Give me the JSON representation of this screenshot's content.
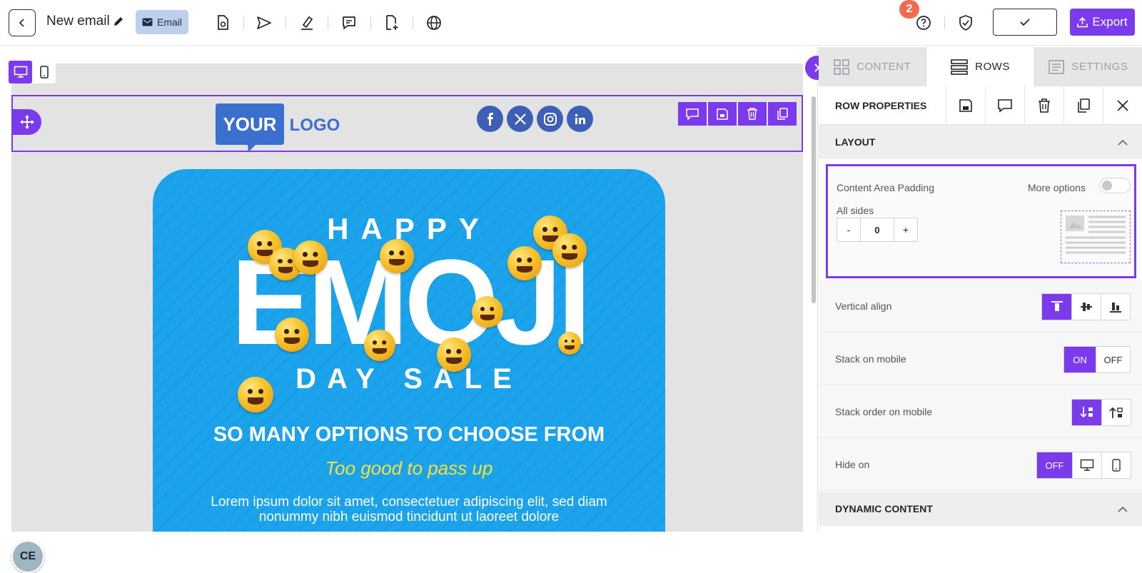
{
  "header": {
    "title": "New email",
    "email_chip": "Email",
    "notification_count": "2",
    "export_label": "Export"
  },
  "canvas": {
    "logo": {
      "your": "YOUR",
      "logo": "LOGO"
    },
    "hero": {
      "happy": "HAPPY",
      "emoji": "EMOJI",
      "day_sale": "DAY SALE",
      "headline": "SO MANY OPTIONS TO CHOOSE FROM",
      "tagline": "Too good to pass up",
      "body": "Lorem ipsum dolor sit amet, consectetuer adipiscing elit, sed diam nonummy nibh euismod tincidunt ut laoreet dolore"
    },
    "avatar": "CE"
  },
  "panel": {
    "tabs": [
      {
        "label": "CONTENT",
        "icon": "grid-icon"
      },
      {
        "label": "ROWS",
        "icon": "rows-icon",
        "active": true
      },
      {
        "label": "SETTINGS",
        "icon": "settings-icon"
      }
    ],
    "row_properties": "ROW PROPERTIES",
    "layout": "LAYOUT",
    "content_area_padding": "Content Area Padding",
    "more_options": "More options",
    "all_sides": "All sides",
    "padding_value": "0",
    "minus": "-",
    "plus": "+",
    "vertical_align": "Vertical align",
    "stack_on_mobile": "Stack on mobile",
    "stack_on": "ON",
    "stack_off": "OFF",
    "stack_order": "Stack order on mobile",
    "hide_on": "Hide on",
    "hide_off": "OFF",
    "dynamic_content": "DYNAMIC CONTENT"
  },
  "colors": {
    "accent": "#7c3aed",
    "hero_blue": "#1ba4ec",
    "tagline": "#f7e13a",
    "notify": "#f06b4f"
  }
}
